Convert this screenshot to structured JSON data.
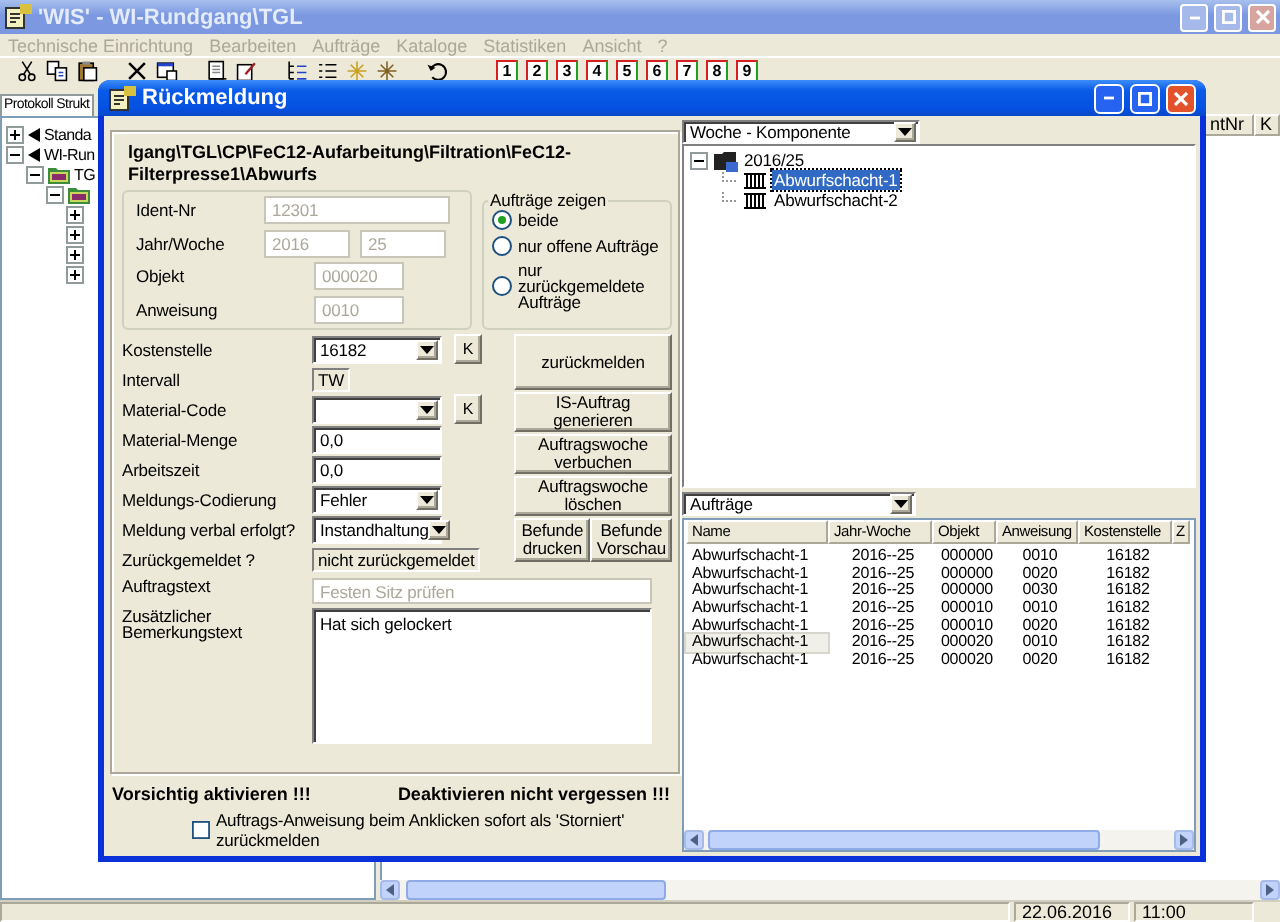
{
  "window": {
    "title": "'WIS' - WI-Rundgang\\TGL"
  },
  "menu": [
    {
      "label": "Technische Einrichtung",
      "disabled": true
    },
    {
      "label": "Bearbeiten",
      "disabled": true
    },
    {
      "label": "Aufträge",
      "disabled": true
    },
    {
      "label": "Kataloge",
      "disabled": true
    },
    {
      "label": "Statistiken",
      "disabled": true
    },
    {
      "label": "Ansicht",
      "disabled": true
    },
    {
      "label": "?",
      "disabled": true
    }
  ],
  "toolbar": {
    "number_buttons": [
      "1",
      "2",
      "3",
      "4",
      "5",
      "6",
      "7",
      "8",
      "9"
    ]
  },
  "structure_panel": {
    "tab": "Protokoll Strukt",
    "tree": [
      {
        "label": "Standa",
        "expanded": false
      },
      {
        "label": "WI-Run",
        "expanded": true,
        "children": [
          {
            "label": "TG",
            "expanded": true,
            "children": [
              {
                "expanded": true,
                "children": [
                  {
                    "expanded": false
                  },
                  {
                    "expanded": false
                  },
                  {
                    "expanded": false
                  },
                  {
                    "expanded": false
                  }
                ]
              }
            ]
          }
        ]
      }
    ]
  },
  "list": {
    "columns": [
      "ntNr",
      "K"
    ]
  },
  "status_bar": {
    "date": "22.06.2016",
    "time": "11:00"
  },
  "dialog": {
    "title": "Rückmeldung",
    "path": "lgang\\TGL\\CP\\FeC12-Aufarbeitung\\Filtration\\FeC12-Filterpresse1\\Abwurfs",
    "ident_fields": [
      {
        "kind": "wide",
        "label": "Ident-Nr",
        "values": [
          "12301"
        ],
        "disabled": true
      },
      {
        "kind": "pair",
        "label": "Jahr/Woche",
        "values": [
          "2016",
          "25"
        ],
        "disabled": true
      },
      {
        "kind": "short",
        "label": "Objekt",
        "values": [
          "000020"
        ],
        "disabled": true
      },
      {
        "kind": "short",
        "label": "Anweisung",
        "values": [
          "0010"
        ],
        "disabled": true
      }
    ],
    "show_orders": {
      "title": "Aufträge zeigen",
      "options": [
        {
          "label": "beide",
          "selected": true
        },
        {
          "label": "nur offene Aufträge",
          "selected": false
        },
        {
          "label": "nur zurückgemeldete Aufträge",
          "selected": false
        }
      ]
    },
    "fields": [
      {
        "kind": "combo",
        "label": "Kostenstelle",
        "value": "16182",
        "button": "K"
      },
      {
        "kind": "display",
        "label": "Intervall",
        "value": "TW"
      },
      {
        "kind": "combo",
        "label": "Material-Code",
        "button": "K"
      },
      {
        "kind": "text",
        "label": "Material-Menge",
        "value": "0,0"
      },
      {
        "kind": "text",
        "label": "Arbeitszeit",
        "value": "0,0"
      },
      {
        "kind": "combo",
        "label": "Meldungs-Codierung",
        "value": "Fehler"
      },
      {
        "kind": "combo",
        "label": "Meldung verbal erfolgt?",
        "value": "Instandhaltung"
      },
      {
        "kind": "display",
        "label": "Zurückgemeldet ?",
        "value": "nicht zurückgemeldet"
      }
    ],
    "text_fields": [
      {
        "kind": "text",
        "label": "Auftragstext",
        "value": "Festen Sitz prüfen",
        "disabled": true
      },
      {
        "kind": "textarea",
        "label": "Zusätzlicher Bemerkungstext",
        "value": "Hat sich gelockert",
        "disabled": false
      }
    ],
    "actions": [
      {
        "kind": "tall",
        "label": "zurückmelden"
      },
      {
        "kind": "full",
        "label": "IS-Auftrag generieren"
      },
      {
        "kind": "full",
        "label": "Auftragswoche verbuchen"
      },
      {
        "kind": "full",
        "label": "Auftragswoche löschen"
      },
      {
        "kind": "half",
        "label": "Befunde drucken"
      },
      {
        "kind": "half",
        "label": "Befunde Vorschau"
      }
    ],
    "warnings": [
      "Vorsichtig aktivieren !!!",
      "Deaktivieren nicht vergessen !!!"
    ],
    "storno_option": {
      "label": "Auftrags-Anweisung beim Anklicken sofort als 'Storniert' zurückmelden",
      "checked": false
    },
    "components": {
      "view": "Woche - Komponente",
      "tree": [
        {
          "label": "2016/25",
          "expanded": true,
          "children": [
            {
              "label": "Abwurfschacht-1",
              "selected": true
            },
            {
              "label": "Abwurfschacht-2",
              "selected": false
            }
          ]
        }
      ]
    },
    "orders": {
      "filter": "Aufträge",
      "columns": [
        "Name",
        "Jahr-Woche",
        "Objekt",
        "Anweisung",
        "Kostenstelle",
        "Z"
      ],
      "rows": [
        {
          "cells": [
            "Abwurfschacht-1",
            "2016--25",
            "000000",
            "0010",
            "16182"
          ],
          "selected": false
        },
        {
          "cells": [
            "Abwurfschacht-1",
            "2016--25",
            "000000",
            "0020",
            "16182"
          ],
          "selected": false
        },
        {
          "cells": [
            "Abwurfschacht-1",
            "2016--25",
            "000000",
            "0030",
            "16182"
          ],
          "selected": false
        },
        {
          "cells": [
            "Abwurfschacht-1",
            "2016--25",
            "000010",
            "0010",
            "16182"
          ],
          "selected": false
        },
        {
          "cells": [
            "Abwurfschacht-1",
            "2016--25",
            "000010",
            "0020",
            "16182"
          ],
          "selected": false
        },
        {
          "cells": [
            "Abwurfschacht-1",
            "2016--25",
            "000020",
            "0010",
            "16182"
          ],
          "selected": true
        },
        {
          "cells": [
            "Abwurfschacht-1",
            "2016--25",
            "000020",
            "0020",
            "16182"
          ],
          "selected": false
        }
      ]
    }
  }
}
